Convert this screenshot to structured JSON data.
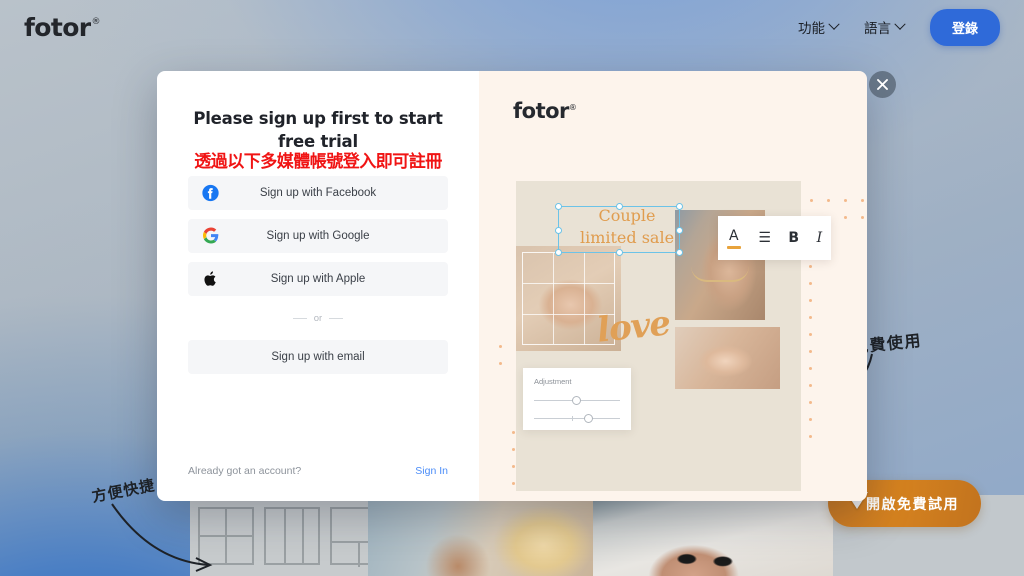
{
  "site": {
    "logo": "fotor",
    "logo_mark": "®",
    "nav": [
      {
        "label": "功能",
        "icon": "chevron-down-icon"
      },
      {
        "label": "語言",
        "icon": "chevron-down-icon"
      }
    ],
    "login_button": "登錄"
  },
  "annotations": {
    "left_handwritten": "方便快捷",
    "right_handwritten": "免費使用",
    "red_overlay_note": "透過以下多媒體帳號登入即可註冊"
  },
  "cta": {
    "label": "開啟免費試用"
  },
  "modal": {
    "close_icon": "close-icon",
    "signup": {
      "title": "Please sign up first to start free trial",
      "providers": [
        {
          "label": "Sign up with Facebook",
          "icon": "facebook-icon",
          "color": "#1877F2"
        },
        {
          "label": "Sign up with Google",
          "icon": "google-icon",
          "color": "#4285F4"
        },
        {
          "label": "Sign up with Apple",
          "icon": "apple-icon",
          "color": "#111111"
        }
      ],
      "divider": "or",
      "email_button": "Sign up with email",
      "footer_question": "Already got an account?",
      "footer_link": "Sign In"
    },
    "promo": {
      "logo": "fotor",
      "logo_mark": "®",
      "headline_line1": "Couple",
      "headline_line2": "limited sale",
      "script_word": "love",
      "text_toolbar": [
        {
          "label": "A",
          "icon": "text-color-icon"
        },
        {
          "label": "☰",
          "icon": "align-icon"
        },
        {
          "label": "B",
          "icon": "bold-icon"
        },
        {
          "label": "I",
          "icon": "italic-icon"
        }
      ],
      "adjustment_panel": {
        "title": "Adjustment",
        "slider1_value": 52,
        "slider2_value": 68
      }
    }
  },
  "colors": {
    "accent_blue": "#2f6ad9",
    "cta_orange": "#d5821f",
    "promo_bg": "#fdf4ec",
    "promo_text": "#e09c4e",
    "note_red": "#f01414",
    "link_blue": "#4b8df8"
  }
}
